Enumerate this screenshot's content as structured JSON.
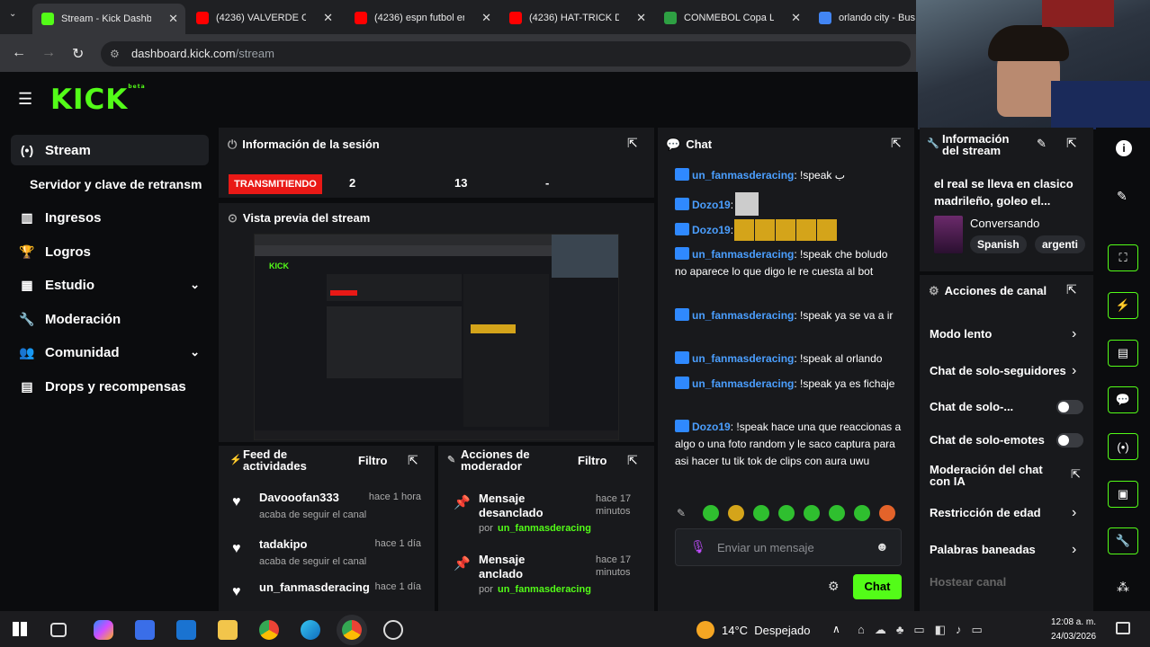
{
  "browser": {
    "tabs": [
      {
        "title": "Stream - Kick Dashbo",
        "color": "#53fc18"
      },
      {
        "title": "(4236) VALVERDE CL/",
        "color": "#ff0000"
      },
      {
        "title": "(4236) espn futbol en",
        "color": "#ff0000"
      },
      {
        "title": "(4236) HAT-TRICK DE",
        "color": "#ff0000"
      },
      {
        "title": "CONMEBOL Copa Lib",
        "color": "#2ea043"
      },
      {
        "title": "orlando city - Bus",
        "color": "#4285f4"
      }
    ],
    "url_host": "dashboard.kick.com",
    "url_path": "/stream"
  },
  "app": {
    "logo": "KICK",
    "logo_badge": "beta",
    "sidebar": [
      {
        "label": "Stream",
        "icon": "stream-icon",
        "glyph": "(•)"
      },
      {
        "label": "Servidor y clave de retransm",
        "icon": "",
        "glyph": ""
      },
      {
        "label": "Ingresos",
        "icon": "revenue-icon",
        "glyph": "▥"
      },
      {
        "label": "Logros",
        "icon": "trophy-icon",
        "glyph": "🏆"
      },
      {
        "label": "Estudio",
        "icon": "studio-icon",
        "glyph": "▦"
      },
      {
        "label": "Moderación",
        "icon": "wrench-icon",
        "glyph": "🔧"
      },
      {
        "label": "Comunidad",
        "icon": "community-icon",
        "glyph": "👥"
      },
      {
        "label": "Drops y recompensas",
        "icon": "drops-icon",
        "glyph": "▤"
      }
    ],
    "session": {
      "title": "Información de la sesión",
      "status": "TRANSMITIENDO",
      "stat1": "2",
      "stat2": "13",
      "stat3": "-"
    },
    "preview": {
      "title": "Vista previa del stream"
    },
    "feed": {
      "title": "Feed de actividades",
      "filter": "Filtro",
      "items": [
        {
          "user": "Davooofan333",
          "time": "hace 1 hora",
          "action": "acaba de seguir el canal"
        },
        {
          "user": "tadakipo",
          "time": "hace 1 día",
          "action": "acaba de seguir el canal"
        },
        {
          "user": "un_fanmasderacing",
          "time": "hace 1 día",
          "action": ""
        }
      ]
    },
    "modactions": {
      "title": "Acciones de moderador",
      "filter": "Filtro",
      "items": [
        {
          "action": "Mensaje desanclado",
          "time": "hace 17 minutos",
          "by": "por",
          "user": "un_fanmasderacing"
        },
        {
          "action": "Mensaje anclado",
          "time": "hace 17 minutos",
          "by": "por",
          "user": "un_fanmasderacing"
        }
      ]
    },
    "chat": {
      "title": "Chat",
      "messages": [
        {
          "user": "un_fanmasderacing",
          "text": ": !speak ب"
        },
        {
          "user": "Dozo19",
          "text": ":"
        },
        {
          "user": "Dozo19",
          "text": ":"
        },
        {
          "user": "un_fanmasderacing",
          "text": ": !speak che boludo no aparece lo que digo le re cuesta al bot"
        },
        {
          "user": "un_fanmasderacing",
          "text": ": !speak ya se va a ir"
        },
        {
          "user": "un_fanmasderacing",
          "text": ": !speak al orlando"
        },
        {
          "user": "un_fanmasderacing",
          "text": ": !speak ya es fichaje"
        },
        {
          "user": "Dozo19",
          "text": ": !speak hace una que reaccionas a algo o una foto random y le saco captura para asi hacer tu tik tok de clips con aura uwu"
        }
      ],
      "placeholder": "Enviar un mensaje",
      "send": "Chat"
    },
    "streaminfo": {
      "title": "Información del stream",
      "stream_title": "el real se lleva en clasico madrileño, goleo el...",
      "category": "Conversando",
      "tags": [
        "Spanish",
        "argenti"
      ]
    },
    "channel_actions": {
      "title": "Acciones de canal",
      "items": [
        {
          "label": "Modo lento",
          "ctrl": "chevron"
        },
        {
          "label": "Chat de solo-seguidores",
          "ctrl": "chevron"
        },
        {
          "label": "Chat de solo-...",
          "ctrl": "toggle"
        },
        {
          "label": "Chat de solo-emotes",
          "ctrl": "toggle"
        },
        {
          "label": "Moderación del chat con IA",
          "ctrl": "external"
        },
        {
          "label": "Restricción de edad",
          "ctrl": "chevron"
        },
        {
          "label": "Palabras baneadas",
          "ctrl": "chevron"
        },
        {
          "label": "Hostear canal",
          "ctrl": "none"
        }
      ]
    }
  },
  "taskbar": {
    "weather": "14°C  Despejado",
    "time": "12:08 a. m.",
    "date": "24/03/2026"
  },
  "colors": {
    "accent": "#53fc18",
    "live": "#e91916",
    "link": "#4b9fff"
  }
}
